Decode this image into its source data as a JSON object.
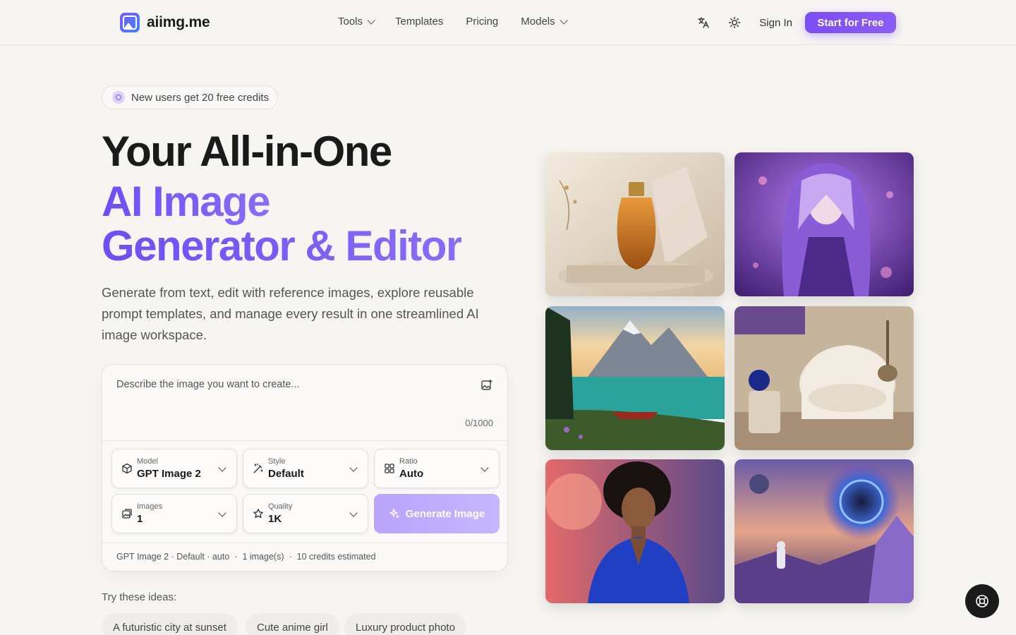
{
  "header": {
    "logo_text": "aiimg.me",
    "nav": [
      {
        "label": "Tools",
        "has_dropdown": true
      },
      {
        "label": "Templates",
        "has_dropdown": false
      },
      {
        "label": "Pricing",
        "has_dropdown": false
      },
      {
        "label": "Models",
        "has_dropdown": true
      }
    ],
    "sign_in": "Sign In",
    "cta": "Start for Free"
  },
  "hero": {
    "badge": "New users get 20 free credits",
    "title_line1": "Your All-in-One",
    "title_line2": "AI Image",
    "title_line3": "Generator & Editor",
    "description": "Generate from text, edit with reference images, explore reusable prompt templates, and manage every result in one streamlined AI image workspace."
  },
  "generator": {
    "prompt_placeholder": "Describe the image you want to create...",
    "char_count": "0/1000",
    "model": {
      "label": "Model",
      "value": "GPT Image 2"
    },
    "style": {
      "label": "Style",
      "value": "Default"
    },
    "ratio": {
      "label": "Ratio",
      "value": "Auto"
    },
    "images": {
      "label": "Images",
      "value": "1"
    },
    "quality": {
      "label": "Quality",
      "value": "1K"
    },
    "generate_button": "Generate Image",
    "summary": [
      "GPT Image 2 · Default · auto",
      "·",
      "1 image(s)",
      "·",
      "10 credits estimated"
    ]
  },
  "ideas": {
    "label": "Try these ideas:",
    "chips": [
      "A futuristic city at sunset",
      "Cute anime girl",
      "Luxury product photo"
    ]
  },
  "gallery": {
    "tiles": [
      "perfume-bottle-photo",
      "anime-girl-illustration",
      "mountain-lake-landscape",
      "armchair-interior-photo",
      "portrait-woman-blue-blazer",
      "astronaut-space-portal"
    ]
  },
  "colors": {
    "accent": "#7b4df5",
    "accent_light": "#b9a4fb",
    "background": "#f6f5f2"
  }
}
